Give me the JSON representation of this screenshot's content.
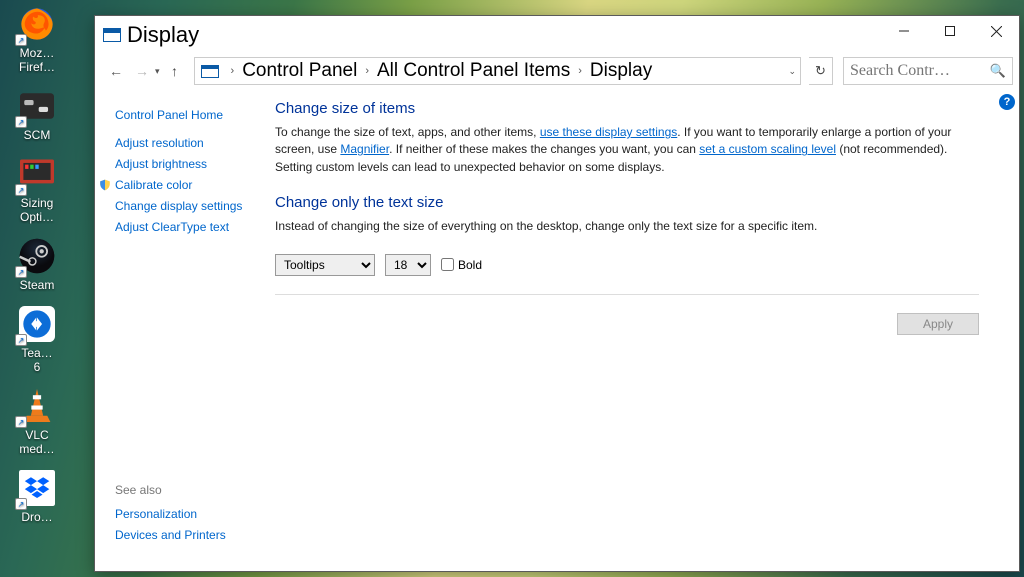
{
  "desktop": {
    "icons": [
      {
        "label": "Moz…",
        "sub": "Firef…"
      },
      {
        "label": "SCM",
        "sub": ""
      },
      {
        "label": "Sizing",
        "sub": "Opti…"
      },
      {
        "label": "Steam",
        "sub": ""
      },
      {
        "label": "Tea…",
        "sub": "6"
      },
      {
        "label": "VLC",
        "sub": "med…"
      },
      {
        "label": "Dro…",
        "sub": ""
      }
    ]
  },
  "window": {
    "title": "Display",
    "breadcrumbs": [
      "Control Panel",
      "All Control Panel Items",
      "Display"
    ],
    "search_placeholder": "Search Contr…"
  },
  "sidebar": {
    "home": "Control Panel Home",
    "links": [
      "Adjust resolution",
      "Adjust brightness",
      "Calibrate color",
      "Change display settings",
      "Adjust ClearType text"
    ],
    "see_also": "See also",
    "lower": [
      "Personalization",
      "Devices and Printers"
    ]
  },
  "main": {
    "section1_title": "Change size of items",
    "section1_text_a": "To change the size of text, apps, and other items, ",
    "section1_link_a": "use these display settings",
    "section1_text_b": ".  If you want to temporarily enlarge a portion of your screen, use ",
    "section1_link_b": "Magnifier",
    "section1_text_c": ".  If neither of these makes the changes you want, you can ",
    "section1_link_c": "set a custom scaling level",
    "section1_text_d": " (not recommended).  Setting custom levels can lead to unexpected behavior on some displays.",
    "section2_title": "Change only the text size",
    "section2_text": "Instead of changing the size of everything on the desktop, change only the text size for a specific item.",
    "text_item_select": "Tooltips",
    "text_size_select": "18",
    "bold_label": "Bold",
    "apply_label": "Apply"
  }
}
